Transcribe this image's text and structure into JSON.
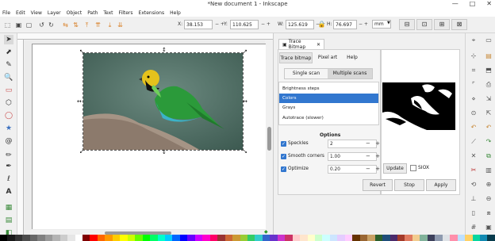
{
  "app": {
    "title": "*New document 1 - Inkscape"
  },
  "window_controls": {
    "minimize": "—",
    "maximize": "□",
    "close": "✕"
  },
  "menu": [
    "File",
    "Edit",
    "View",
    "Layer",
    "Object",
    "Path",
    "Text",
    "Filters",
    "Extensions",
    "Help"
  ],
  "toolbar": {
    "x_label": "X:",
    "x_value": "38.153",
    "y_label": "Y:",
    "y_value": "110.625",
    "w_label": "W:",
    "w_value": "125.619",
    "h_label": "H:",
    "h_value": "76.697",
    "unit": "mm",
    "pm": "− +"
  },
  "dialog": {
    "tab_label": "Trace Bitmap",
    "tab_close": "✕",
    "subtabs": [
      "Trace bitmap",
      "Pixel art",
      "Help"
    ],
    "scan_modes": [
      "Single scan",
      "Multiple scans"
    ],
    "modes": [
      "Brightness steps",
      "Colors",
      "Grays",
      "Autotrace (slower)"
    ],
    "selected_mode": 1,
    "options_title": "Options",
    "options": [
      {
        "label": "Speckles",
        "value": "2",
        "checked": true
      },
      {
        "label": "Smooth corners",
        "value": "1.00",
        "checked": true
      },
      {
        "label": "Optimize",
        "value": "0.20",
        "checked": true
      }
    ],
    "update_label": "Update",
    "siox_label": "SIOX",
    "revert_label": "Revert",
    "stop_label": "Stop",
    "apply_label": "Apply"
  },
  "colors": {
    "accent": "#3277cf"
  },
  "icons": {
    "tools": [
      "selector-icon",
      "node-icon",
      "tweak-icon",
      "zoom-icon",
      "rect-icon",
      "ellipse-icon",
      "star-icon",
      "box3d-icon",
      "spiral-icon",
      "pencil-icon",
      "pen-icon",
      "calligraphy-icon",
      "text-icon",
      "spray-icon",
      "eraser-icon",
      "bucket-icon",
      "gradient-icon",
      "dropper-icon"
    ]
  },
  "palette": [
    "#000000",
    "#1a1a1a",
    "#333333",
    "#4d4d4d",
    "#666666",
    "#808080",
    "#999999",
    "#b3b3b3",
    "#cccccc",
    "#e6e6e6",
    "#ffffff",
    "#800000",
    "#ff0000",
    "#ff6600",
    "#ff9900",
    "#ffcc00",
    "#ffff00",
    "#ccff00",
    "#66ff00",
    "#00ff00",
    "#00ff66",
    "#00ffcc",
    "#00ccff",
    "#0066ff",
    "#0000ff",
    "#6600ff",
    "#cc00ff",
    "#ff00cc",
    "#ff0066",
    "#993333",
    "#cc6633",
    "#cc9933",
    "#99cc33",
    "#33cc66",
    "#33cccc",
    "#3366cc",
    "#6633cc",
    "#cc33cc",
    "#cc3366",
    "#ffcccc",
    "#ffe5cc",
    "#ffffcc",
    "#ccffcc",
    "#ccffff",
    "#cce5ff",
    "#e5ccff",
    "#ffccff",
    "#663300",
    "#996633",
    "#c8a064",
    "#2b5f2b",
    "#1e4d7a",
    "#4b2a6b",
    "#a33a2a",
    "#e07a5f",
    "#f2cc8f",
    "#81b29a",
    "#3d405b",
    "#8e9aaf",
    "#dee2e6",
    "#ff8fab",
    "#bde0fe",
    "#ffd166",
    "#06d6a0",
    "#118ab2",
    "#073b4c"
  ]
}
